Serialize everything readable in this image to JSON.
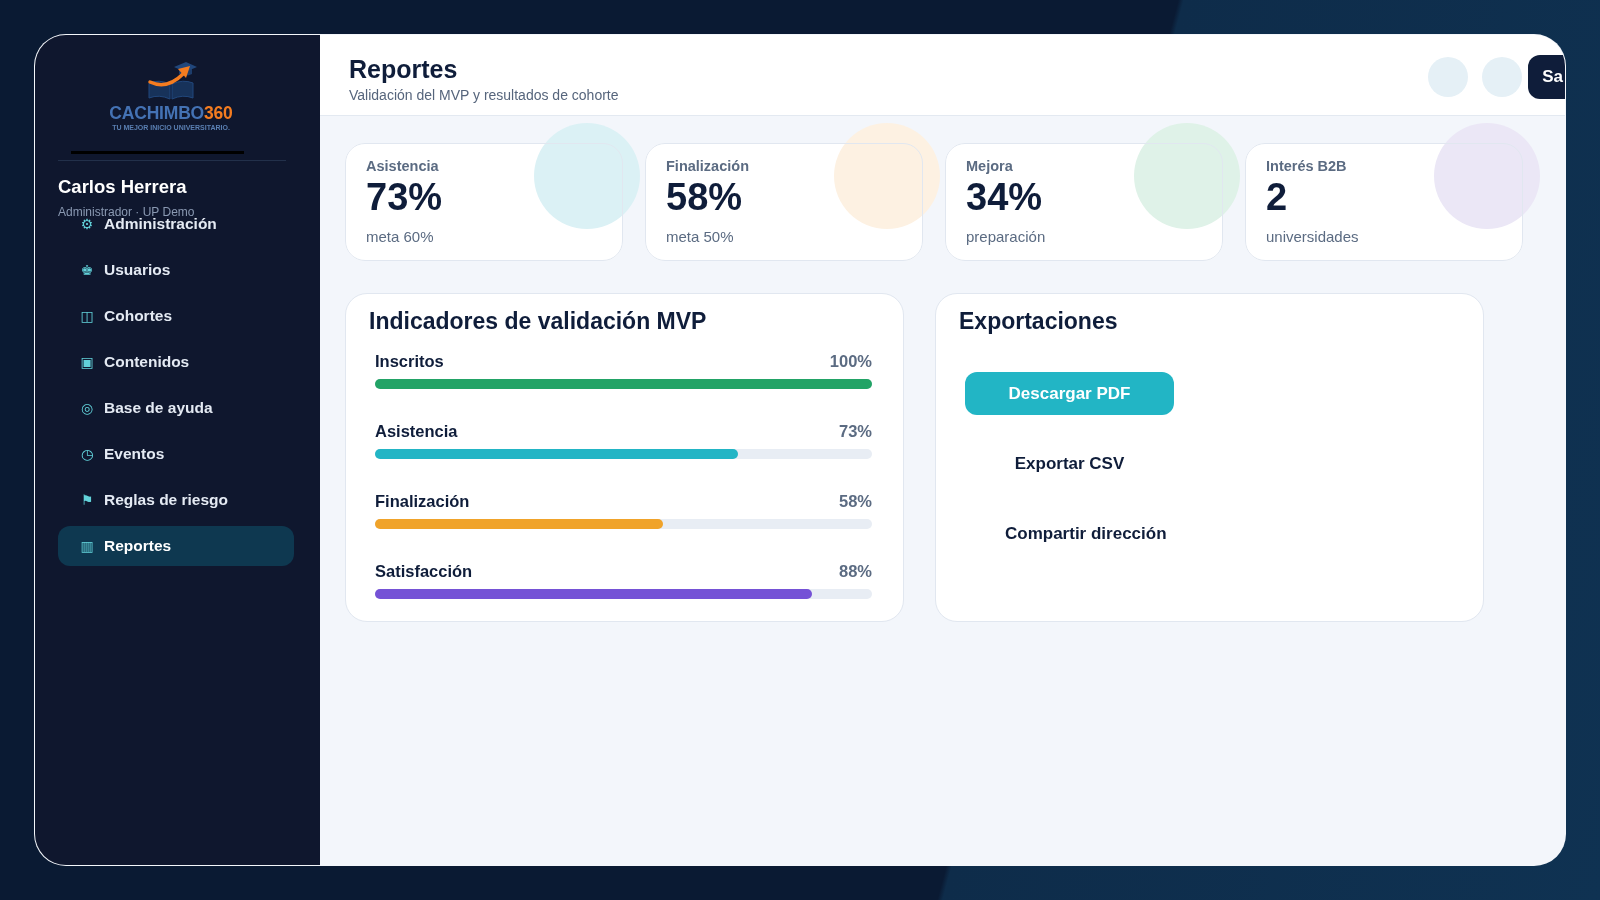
{
  "sidebar": {
    "logo": {
      "wordmark": "CACHIMBO",
      "wordmark_accent": "360",
      "tagline": "TU MEJOR INICIO UNIVERSITARIO."
    },
    "user": {
      "name": "Carlos Herrera",
      "role": "Administrador · UP Demo"
    },
    "items": [
      {
        "icon": "⚙",
        "label": "Administración",
        "selected": false
      },
      {
        "icon": "♚",
        "label": "Usuarios",
        "selected": false
      },
      {
        "icon": "◫",
        "label": "Cohortes",
        "selected": false
      },
      {
        "icon": "▣",
        "label": "Contenidos",
        "selected": false
      },
      {
        "icon": "◎",
        "label": "Base de ayuda",
        "selected": false
      },
      {
        "icon": "◷",
        "label": "Eventos",
        "selected": false
      },
      {
        "icon": "⚑",
        "label": "Reglas de riesgo",
        "selected": false
      },
      {
        "icon": "▥",
        "label": "Reportes",
        "selected": true
      }
    ]
  },
  "header": {
    "title": "Reportes",
    "subtitle": "Validación del MVP y resultados de cohorte",
    "action_button": "Sa"
  },
  "stats": [
    {
      "label": "Asistencia",
      "value": "73%",
      "note": "meta 60%",
      "color": "#dbf1f5"
    },
    {
      "label": "Finalización",
      "value": "58%",
      "note": "meta 50%",
      "color": "#fdf1e2"
    },
    {
      "label": "Mejora",
      "value": "34%",
      "note": "preparación",
      "color": "#dff2e8"
    },
    {
      "label": "Interés B2B",
      "value": "2",
      "note": "universidades",
      "color": "#ebe7f6"
    }
  ],
  "indicators": {
    "title": "Indicadores de validación MVP",
    "rows": [
      {
        "label": "Inscritos",
        "reading": "100%",
        "level": 1.0,
        "color": "#22a366"
      },
      {
        "label": "Asistencia",
        "reading": "73%",
        "level": 0.73,
        "color": "#22b5c5"
      },
      {
        "label": "Finalización",
        "reading": "58%",
        "level": 0.58,
        "color": "#f0a32a"
      },
      {
        "label": "Satisfacción",
        "reading": "88%",
        "level": 0.88,
        "color": "#7552d6"
      }
    ]
  },
  "exports": {
    "title": "Exportaciones",
    "buttons": [
      {
        "label": "Descargar PDF",
        "kind": "primary"
      },
      {
        "label": "Exportar CSV",
        "kind": "plain"
      },
      {
        "label": "Compartir dirección",
        "kind": "plain"
      }
    ]
  }
}
